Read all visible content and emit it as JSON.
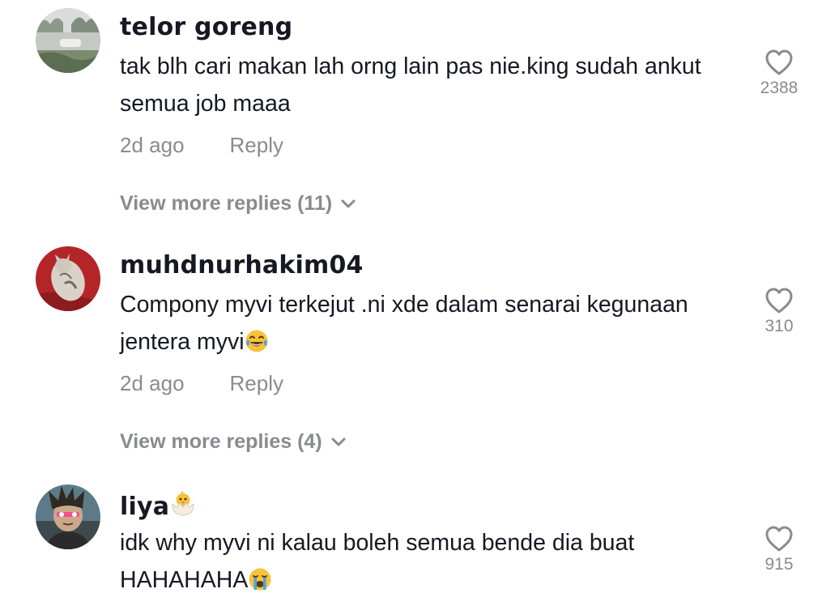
{
  "comments": [
    {
      "username": "telor goreng",
      "text": "tak blh cari makan lah orng lain pas nie.king sudah ankut semua job maaa",
      "time": "2d ago",
      "reply_label": "Reply",
      "more_replies": "View more replies (11)",
      "likes": "2388",
      "avatar_icon": "car-parking-photo"
    },
    {
      "username": "muhdnurhakim04",
      "text": "Compony myvi terkejut .ni xde dalam senarai kegunaan jentera myvi",
      "text_emoji": "😂",
      "time": "2d ago",
      "reply_label": "Reply",
      "more_replies": "View more replies (4)",
      "likes": "310",
      "avatar_icon": "cat-on-red-photo"
    },
    {
      "username": "liya",
      "username_emoji": "🐣",
      "text": "idk why myvi ni kalau boleh semua bende dia buat HAHAHAHA",
      "text_emoji": "😭",
      "likes": "915",
      "avatar_icon": "anime-character-photo"
    }
  ],
  "icons": {
    "like": "heart-outline-icon",
    "expand": "chevron-down-icon"
  },
  "colors": {
    "text": "#161823",
    "muted": "#8a8b91",
    "emoji_yellow": "#f7c23c"
  }
}
